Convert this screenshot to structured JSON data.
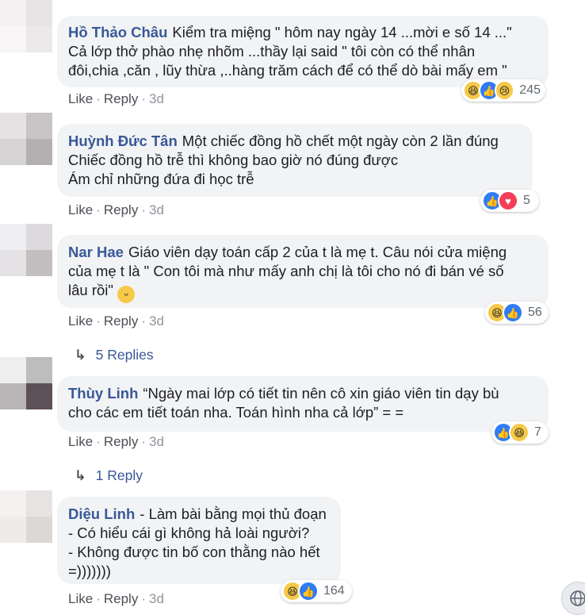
{
  "comments": [
    {
      "author": "Hồ Thảo Châu",
      "lines": [
        "Kiểm tra miệng \" hôm nay ngày 14 ...mời e số 14 ...\"",
        "Cả lớp thở phào nhẹ nhõm ...thầy lại said \" tôi còn có thể nhân",
        "đôi,chia ,căn , lũy thừa ,..hàng trăm cách để có thể dò bài mấy em \""
      ],
      "like": "Like",
      "reply": "Reply",
      "time": "3d",
      "reactions": [
        "haha",
        "like",
        "sad"
      ],
      "count": "245"
    },
    {
      "author": "Huỳnh Đức Tân",
      "lines": [
        "Một chiếc đồng hồ chết một ngày còn 2 lần đúng",
        "Chiếc đồng hồ trễ thì không bao giờ nó đúng được",
        "Ám chỉ những đứa đi học trễ"
      ],
      "like": "Like",
      "reply": "Reply",
      "time": "3d",
      "reactions": [
        "like",
        "love"
      ],
      "count": "5"
    },
    {
      "author": "Nar Hae",
      "lines": [
        "Giáo viên dạy toán cấp 2 của t là mẹ t. Câu nói cửa miệng",
        "của mẹ t là \" Con tôi mà như mấy anh chị là tôi cho nó đi bán vé số",
        "lâu rồi\""
      ],
      "like": "Like",
      "reply": "Reply",
      "time": "3d",
      "reactions": [
        "haha",
        "like"
      ],
      "count": "56",
      "replies": "5 Replies"
    },
    {
      "author": "Thùy Linh",
      "lines": [
        "“Ngày mai lớp có tiết tin nên cô xin giáo viên tin dạy bù",
        "cho các em tiết toán nha. Toán hình nha cả lớp” = ="
      ],
      "like": "Like",
      "reply": "Reply",
      "time": "3d",
      "reactions": [
        "like",
        "haha"
      ],
      "count": "7",
      "replies": "1 Reply"
    },
    {
      "author": "Diệu Linh",
      "lines": [
        "- Làm bài bằng mọi thủ đoạn",
        "- Có hiểu cái gì không hả loài người?",
        "- Không được tin bố con thằng nào hết",
        "=)))))))"
      ],
      "like": "Like",
      "reply": "Reply",
      "time": "3d",
      "reactions": [
        "haha",
        "like"
      ],
      "count": "164"
    }
  ],
  "colors": {
    "author": "#385898",
    "bubble": "#f2f3f5",
    "meta": "#606770"
  },
  "icons": {
    "reply_arrow": "reply-arrow-icon",
    "globe": "globe-icon",
    "inline_emoji": "smile-emoji-icon"
  }
}
